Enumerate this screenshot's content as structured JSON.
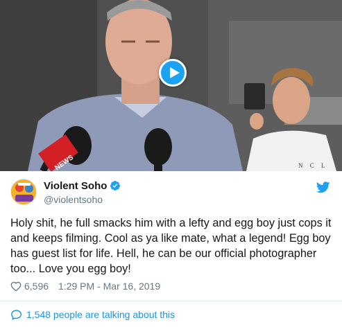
{
  "tweet": {
    "display_name": "Violent Soho",
    "handle": "@violentsoho",
    "text": "Holy shit, he full smacks him with a lefty and egg boy just cops it and keeps filming. Cool as ya like mate, what a legend! Egg boy has guest list for life. Hell, he can be our official photographer too... Love you egg boy!",
    "like_count": "6,596",
    "timestamp": "1:29 PM - Mar 16, 2019",
    "conversation_label": "1,548 people are talking about this"
  },
  "media": {
    "type": "video",
    "overlay_text": "NEWS",
    "shirt_text": "N C L"
  },
  "icons": {
    "play": "play-icon",
    "verified": "verified-badge-icon",
    "twitter": "twitter-bird-icon",
    "like": "heart-icon",
    "conversation": "chat-bubble-icon"
  },
  "colors": {
    "brand_blue": "#1da1f2",
    "link_blue": "#1b95e0",
    "text": "#14171a",
    "secondary_text": "#657786",
    "divider": "#e1e8ed"
  }
}
